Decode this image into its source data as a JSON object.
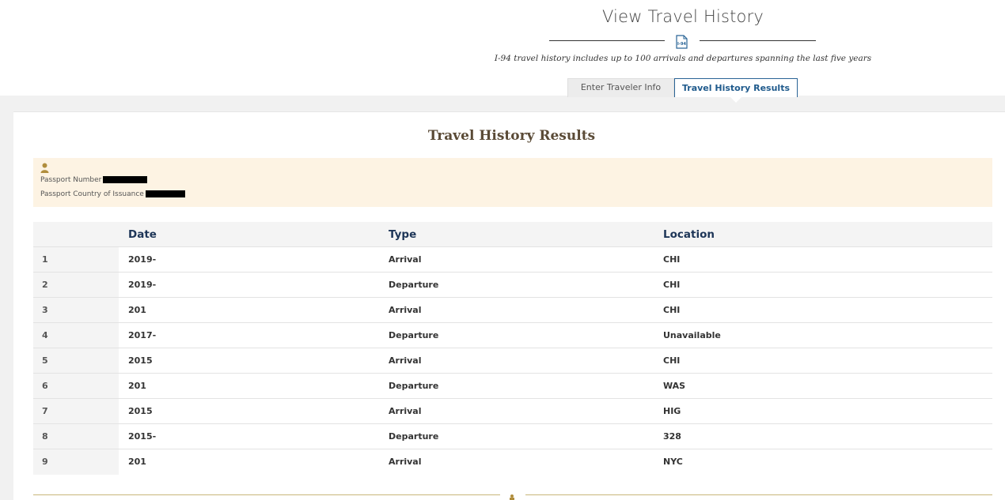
{
  "header": {
    "title": "View Travel History",
    "subtitle": "I-94 travel history includes up to 100 arrivals and departures spanning the last five years",
    "doc_icon": "i94-document-icon"
  },
  "tabs": [
    {
      "label": "Enter Traveler Info",
      "active": false
    },
    {
      "label": "Travel History Results",
      "active": true
    }
  ],
  "results": {
    "heading": "Travel History Results",
    "traveler": {
      "icon": "person-icon",
      "passport_number_label": "Passport Number :",
      "passport_country_label": "Passport Country of Issuance :"
    }
  },
  "table": {
    "columns": [
      "Date",
      "Type",
      "Location"
    ],
    "rows": [
      {
        "num": "1",
        "date": "2019-",
        "type": "Arrival",
        "location": "CHI"
      },
      {
        "num": "2",
        "date": "2019-",
        "type": "Departure",
        "location": "CHI"
      },
      {
        "num": "3",
        "date": "201",
        "type": "Arrival",
        "location": "CHI"
      },
      {
        "num": "4",
        "date": "2017-",
        "type": "Departure",
        "location": "Unavailable"
      },
      {
        "num": "5",
        "date": "2015",
        "type": "Arrival",
        "location": "CHI"
      },
      {
        "num": "6",
        "date": "201",
        "type": "Departure",
        "location": "WAS"
      },
      {
        "num": "7",
        "date": "2015",
        "type": "Arrival",
        "location": "HIG"
      },
      {
        "num": "8",
        "date": "2015-",
        "type": "Departure",
        "location": "328"
      },
      {
        "num": "9",
        "date": "201",
        "type": "Arrival",
        "location": "NYC"
      }
    ]
  },
  "colors": {
    "accent_blue": "#1f5a8c",
    "heading_brown": "#5a4a36",
    "info_box_bg": "#fdf3e3",
    "gold": "#c8b77a"
  }
}
